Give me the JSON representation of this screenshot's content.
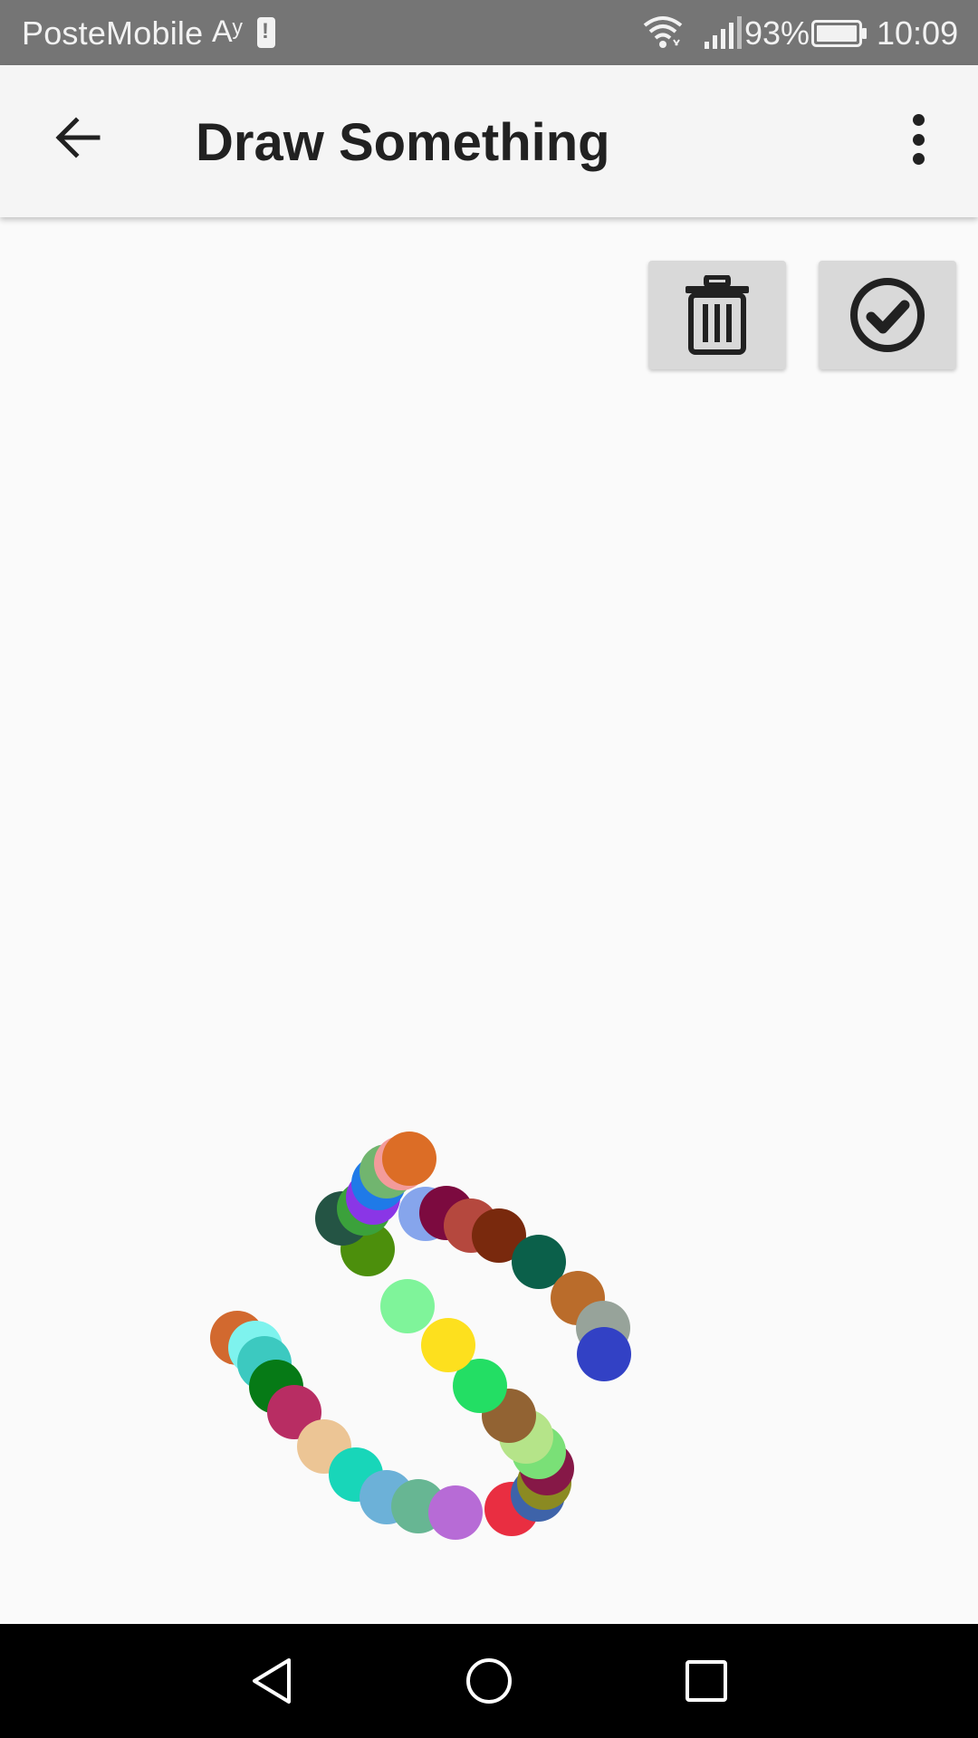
{
  "status_bar": {
    "carrier": "PosteMobile",
    "carrier_suffix": "Aʸ",
    "battery_percent": "93%",
    "time": "10:09"
  },
  "app_bar": {
    "title": "Draw Something",
    "back_icon": "arrow-left-icon",
    "menu_icon": "more-vert-icon"
  },
  "actions": {
    "delete_icon": "trash-icon",
    "confirm_icon": "check-circle-icon"
  },
  "drawing": {
    "dot_colors": [
      "#d2692f",
      "#7ef3ee",
      "#3cc9c0",
      "#067a16",
      "#b82d63",
      "#ecc595",
      "#18d6b9",
      "#6cb1d8",
      "#67b693",
      "#b76bd6",
      "#e92e41",
      "#3e63a9",
      "#8b8a22",
      "#861847",
      "#7ae077",
      "#b5e489",
      "#926333",
      "#23de64",
      "#fde01e",
      "#7ff49a",
      "#4c8f0c",
      "#245444",
      "#3ba13b",
      "#8a36e6",
      "#1f7ae8",
      "#71b56f",
      "#f39b9a",
      "#dc6d26",
      "#86a5ec",
      "#7c0a3f",
      "#b5483e",
      "#79290d",
      "#0b604a",
      "#ba6c2b",
      "#97a39a",
      "#3241c5"
    ]
  },
  "nav_bar": {
    "back_icon": "nav-back-icon",
    "home_icon": "nav-home-icon",
    "recents_icon": "nav-recents-icon"
  }
}
